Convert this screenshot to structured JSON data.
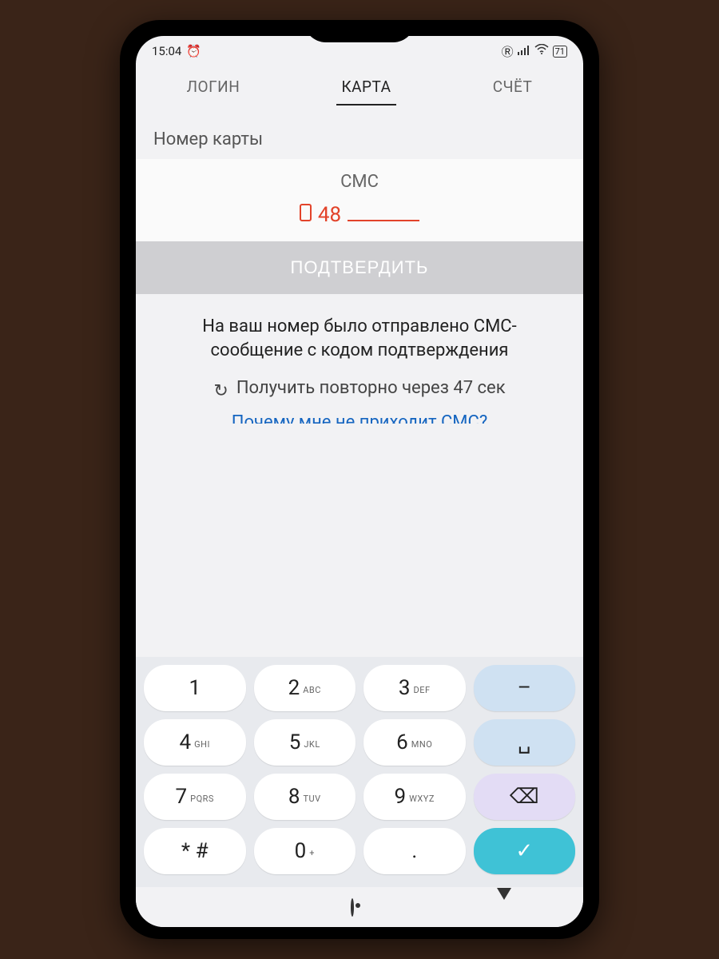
{
  "status": {
    "time": "15:04",
    "alarm_icon": "⏰",
    "r_icon": "Ⓡ",
    "signal_icon": "📶",
    "wifi_icon": "≋",
    "battery": "71"
  },
  "tabs": {
    "login": "ЛОГИН",
    "card": "КАРТА",
    "account": "СЧЁТ"
  },
  "field_label": "Номер карты",
  "sms": {
    "title": "СМС",
    "entered": "48",
    "confirm": "ПОДТВЕРДИТЬ"
  },
  "info": "На ваш номер было отправлено СМС-сообщение с кодом подтверждения",
  "resend": "Получить повторно через 47 сек",
  "link": "Почему мне не приходит СМС?",
  "keys": {
    "k1": "1",
    "k2": "2",
    "k2s": "ABC",
    "k3": "3",
    "k3s": "DEF",
    "dash": "–",
    "k4": "4",
    "k4s": "GHI",
    "k5": "5",
    "k5s": "JKL",
    "k6": "6",
    "k6s": "MNO",
    "space": "␣",
    "k7": "7",
    "k7s": "PQRS",
    "k8": "8",
    "k8s": "TUV",
    "k9": "9",
    "k9s": "WXYZ",
    "bksp": "⌫",
    "sym": "* #",
    "k0": "0",
    "k0s": "+",
    "dot": ".",
    "ok": "✓"
  }
}
